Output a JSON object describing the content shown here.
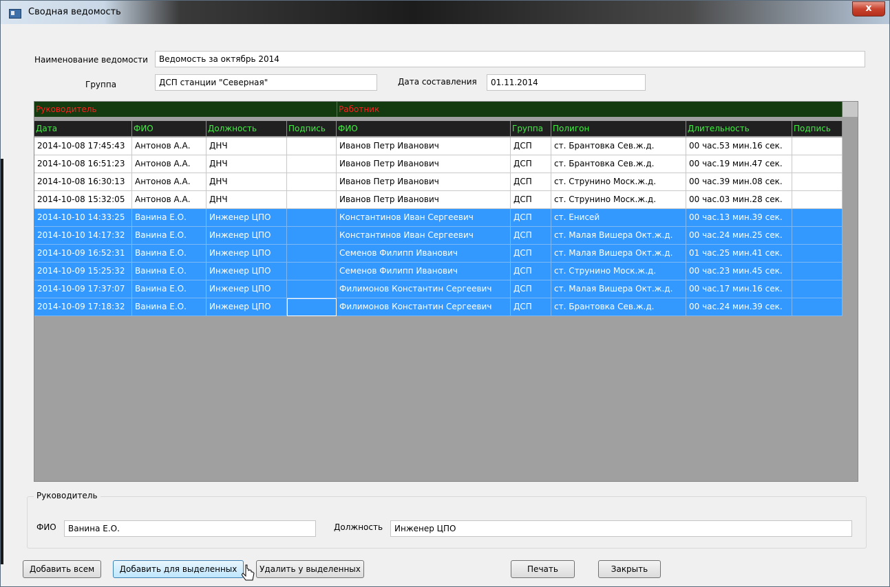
{
  "window": {
    "title": "Сводная ведомость",
    "close_label": "x"
  },
  "form": {
    "name_label": "Наименование ведомости",
    "name_value": "Ведомость за октябрь 2014",
    "group_label": "Группа",
    "group_value": "ДСП станции \"Северная\"",
    "date_label": "Дата составления",
    "date_value": "01.11.2014"
  },
  "grid": {
    "group_headers": {
      "manager": "Руководитель",
      "worker": "Работник"
    },
    "columns": [
      "Дата",
      "ФИО",
      "Должность",
      "Подпись",
      "ФИО",
      "Группа",
      "Полигон",
      "Длительность",
      "Подпись"
    ],
    "rows": [
      [
        "2014-10-08 17:45:43",
        "Антонов А.А.",
        "ДНЧ",
        "",
        "Иванов Петр Иванович",
        "ДСП",
        "ст. Брантовка Сев.ж.д.",
        "00 час.53 мин.16 сек.",
        ""
      ],
      [
        "2014-10-08 16:51:23",
        "Антонов А.А.",
        "ДНЧ",
        "",
        "Иванов Петр Иванович",
        "ДСП",
        "ст. Брантовка Сев.ж.д.",
        "00 час.19 мин.47 сек.",
        ""
      ],
      [
        "2014-10-08 16:30:13",
        "Антонов А.А.",
        "ДНЧ",
        "",
        "Иванов Петр Иванович",
        "ДСП",
        "ст. Струнино Моск.ж.д.",
        "00 час.39 мин.08 сек.",
        ""
      ],
      [
        "2014-10-08 15:32:05",
        "Антонов А.А.",
        "ДНЧ",
        "",
        "Иванов Петр Иванович",
        "ДСП",
        "ст. Струнино Моск.ж.д.",
        "00 час.03 мин.28 сек.",
        ""
      ],
      [
        "2014-10-10 14:33:25",
        "Ванина Е.О.",
        "Инженер ЦПО",
        "",
        "Константинов Иван Сергеевич",
        "ДСП",
        "ст. Енисей",
        "00 час.13 мин.39 сек.",
        ""
      ],
      [
        "2014-10-10 14:17:32",
        "Ванина Е.О.",
        "Инженер ЦПО",
        "",
        "Константинов Иван Сергеевич",
        "ДСП",
        "ст. Малая Вишера Окт.ж.д.",
        "00 час.24 мин.25 сек.",
        ""
      ],
      [
        "2014-10-09 16:52:31",
        "Ванина Е.О.",
        "Инженер ЦПО",
        "",
        "Семенов Филипп Иванович",
        "ДСП",
        "ст. Малая Вишера Окт.ж.д.",
        "01 час.25 мин.41 сек.",
        ""
      ],
      [
        "2014-10-09 15:25:32",
        "Ванина Е.О.",
        "Инженер ЦПО",
        "",
        "Семенов Филипп Иванович",
        "ДСП",
        "ст. Струнино Моск.ж.д.",
        "00 час.23 мин.45 сек.",
        ""
      ],
      [
        "2014-10-09 17:37:07",
        "Ванина Е.О.",
        "Инженер ЦПО",
        "",
        "Филимонов Константин Сергеевич",
        "ДСП",
        "ст. Малая Вишера Окт.ж.д.",
        "00 час.17 мин.16 сек.",
        ""
      ],
      [
        "2014-10-09 17:18:32",
        "Ванина Е.О.",
        "Инженер ЦПО",
        "",
        "Филимонов Константин Сергеевич",
        "ДСП",
        "ст. Брантовка Сев.ж.д.",
        "00 час.24 мин.39 сек.",
        ""
      ]
    ],
    "selected_rows": [
      4,
      5,
      6,
      7,
      8,
      9
    ],
    "focused_cell": [
      9,
      3
    ]
  },
  "manager_box": {
    "title": "Руководитель",
    "fio_label": "ФИО",
    "fio_value": "Ванина Е.О.",
    "position_label": "Должность",
    "position_value": "Инженер ЦПО"
  },
  "buttons": {
    "add_all": "Добавить всем",
    "add_selected": "Добавить для выделенных",
    "remove_selected": "Удалить у выделенных",
    "print": "Печать",
    "close": "Закрыть"
  },
  "colors": {
    "selection": "#3399ff",
    "group_header_bg": "#143a10",
    "group_header_text": "#ff1e1e",
    "column_header_bg": "#202020",
    "column_header_text": "#3df03d"
  }
}
